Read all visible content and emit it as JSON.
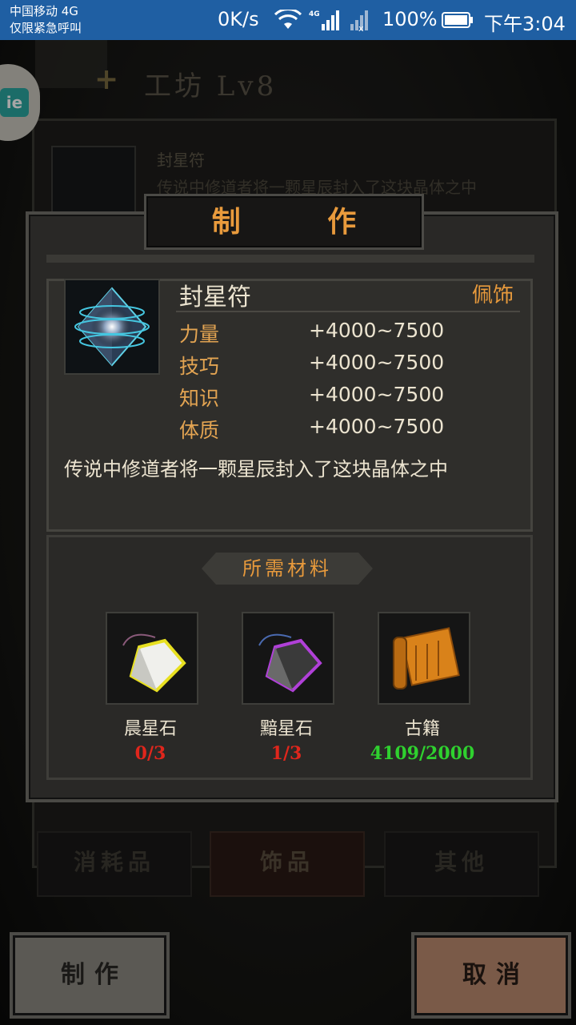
{
  "status_bar": {
    "carrier": "中国移动 4G",
    "emergency": "仅限紧急呼叫",
    "net_speed": "0K/s",
    "network_badge": "4G",
    "battery": "100%",
    "time": "下午3:04"
  },
  "background": {
    "title": "工坊 Lv8",
    "list_item_name": "封星符",
    "list_item_desc": "传说中修道者将一颗星辰封入了这块晶体之中",
    "side_badge": "ie",
    "tabs": [
      "消耗品",
      "饰品",
      "其他"
    ],
    "active_tab": "饰品"
  },
  "dialog": {
    "title": "制 作",
    "item": {
      "name": "封星符",
      "type": "佩饰",
      "icon": "star-crystal-icon",
      "stats": [
        {
          "label": "力量",
          "value": "+4000~7500"
        },
        {
          "label": "技巧",
          "value": "+4000~7500"
        },
        {
          "label": "知识",
          "value": "+4000~7500"
        },
        {
          "label": "体质",
          "value": "+4000~7500"
        }
      ],
      "description": "传说中修道者将一颗星辰封入了这块晶体之中"
    },
    "materials_header": "所需材料",
    "materials": [
      {
        "name": "晨星石",
        "count": "0/3",
        "icon": "morning-star-stone-icon",
        "status": "insufficient"
      },
      {
        "name": "黯星石",
        "count": "1/3",
        "icon": "dark-star-stone-icon",
        "status": "insufficient"
      },
      {
        "name": "古籍",
        "count": "4109/2000",
        "icon": "ancient-scroll-icon",
        "status": "sufficient"
      }
    ],
    "colors": {
      "accent": "#e89a3c",
      "insufficient": "#e0261c",
      "sufficient": "#2fd12f"
    }
  },
  "buttons": {
    "make": "制作",
    "cancel": "取消"
  }
}
